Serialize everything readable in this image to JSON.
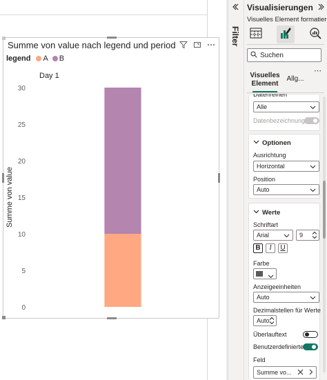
{
  "visual": {
    "title": "Summe von value nach legend und period",
    "legend_title": "legend",
    "legend_entries": [
      {
        "label": "A",
        "color": "#FFA882"
      },
      {
        "label": "B",
        "color": "#B385AF"
      }
    ]
  },
  "chart_data": {
    "type": "bar",
    "stacked": true,
    "title": "Summe von value nach legend und period",
    "categories": [
      "Day 1"
    ],
    "series": [
      {
        "name": "A",
        "values": [
          10
        ],
        "color": "#FFA882"
      },
      {
        "name": "B",
        "values": [
          20
        ],
        "color": "#B385AF"
      }
    ],
    "ylabel": "Summe von value",
    "xlabel": "",
    "ylim": [
      0,
      30
    ],
    "yticks": [
      0,
      5,
      10,
      15,
      20,
      25,
      30
    ],
    "category_label_position": "top",
    "legend_position": "top-left",
    "grid": false
  },
  "filter_pane": {
    "label": "Filter"
  },
  "viz_pane": {
    "title": "Visualisierungen",
    "subtitle": "Visuelles Element formatieren",
    "search_placeholder": "Suchen",
    "tabs": {
      "active": "Visuelles Element",
      "other": "Allg..."
    },
    "datenreihen": {
      "label": "Datenreihen",
      "value": "Alle",
      "data_labels_caption": "Datenbezeichnung..."
    },
    "optionen": {
      "heading": "Optionen",
      "ausrichtung_label": "Ausrichtung",
      "ausrichtung_value": "Horizontal",
      "position_label": "Position",
      "position_value": "Auto"
    },
    "werte": {
      "heading": "Werte",
      "schriftart_label": "Schriftart",
      "font_value": "Arial",
      "size_value": "9",
      "bold": "B",
      "italic": "I",
      "underline": "U",
      "farbe_label": "Farbe",
      "farbe_color": "#595959",
      "anzeige_label": "Anzeigeeinheiten",
      "anzeige_value": "Auto",
      "dezimal_label": "Dezimalstellen für Werte",
      "dezimal_value": "Auto",
      "ueberlauf_label": "Überlauftext",
      "benutzer_label": "Benutzerdefinierte ...",
      "feld_label": "Feld",
      "feld_value": "Summe vo..."
    },
    "accent_color": "#117865"
  }
}
